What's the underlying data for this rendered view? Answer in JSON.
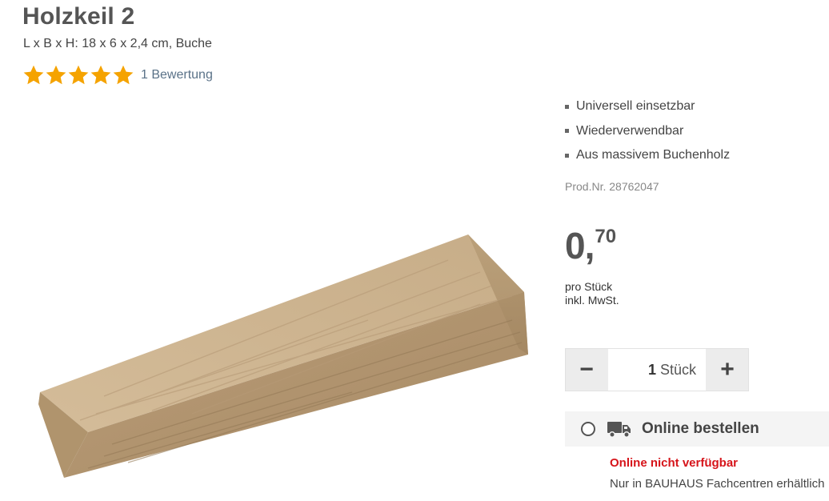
{
  "product": {
    "title": "Holzkeil 2",
    "subtitle": "L x B x H: 18 x 6 x 2,4 cm, Buche",
    "rating": {
      "stars": 5,
      "max": 5,
      "count_label": "1 Bewertung"
    },
    "features": [
      "Universell einsetzbar",
      "Wiederverwendbar",
      "Aus massivem Buchenholz"
    ],
    "prod_nr": "Prod.Nr. 28762047"
  },
  "price": {
    "integer": "0,",
    "decimal": "70",
    "unit": "pro Stück",
    "tax": "inkl. MwSt."
  },
  "quantity": {
    "minus_label": "−",
    "plus_label": "+",
    "value": "1",
    "unit": "Stück"
  },
  "delivery": {
    "option_title": "Online bestellen",
    "status": "Online nicht verfügbar",
    "note": "Nur in BAUHAUS Fachcentren erhältlich",
    "status_color": "#d6141a"
  },
  "colors": {
    "star": "#f5a300",
    "rating_link": "#5a7288"
  },
  "icons": {
    "star": "star-icon",
    "bullet": "square-bullet-icon",
    "radio": "radio-icon",
    "truck": "truck-icon"
  }
}
